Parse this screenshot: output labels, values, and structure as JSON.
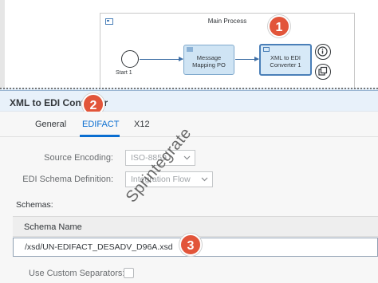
{
  "process": {
    "pool_title": "Main Process",
    "start_event_label": "Start 1",
    "tasks": [
      {
        "label_line1": "Message",
        "label_line2": "Mapping PO"
      },
      {
        "label_line1": "XML to EDI",
        "label_line2": "Converter 1"
      }
    ]
  },
  "callouts": [
    "1",
    "2",
    "3"
  ],
  "panel": {
    "title": "XML to EDI Converter",
    "tabs": [
      {
        "label": "General",
        "active": false
      },
      {
        "label": "EDIFACT",
        "active": true
      },
      {
        "label": "X12",
        "active": false
      }
    ]
  },
  "form": {
    "source_encoding": {
      "label": "Source Encoding:",
      "value": "ISO-8859"
    },
    "schema_definition": {
      "label": "EDI Schema Definition:",
      "value": "Integration Flow"
    },
    "schemas_label": "Schemas:",
    "schemas_table": {
      "column_header": "Schema Name",
      "rows": [
        "/xsd/UN-EDIFACT_DESADV_D96A.xsd"
      ]
    },
    "custom_separators": {
      "label": "Use Custom Separators:",
      "checked": false
    }
  },
  "watermark": "Sprintegrate",
  "colors": {
    "accent": "#0a6ed1",
    "callout": "#e2553a",
    "task_fill": "#cfe4f4"
  }
}
